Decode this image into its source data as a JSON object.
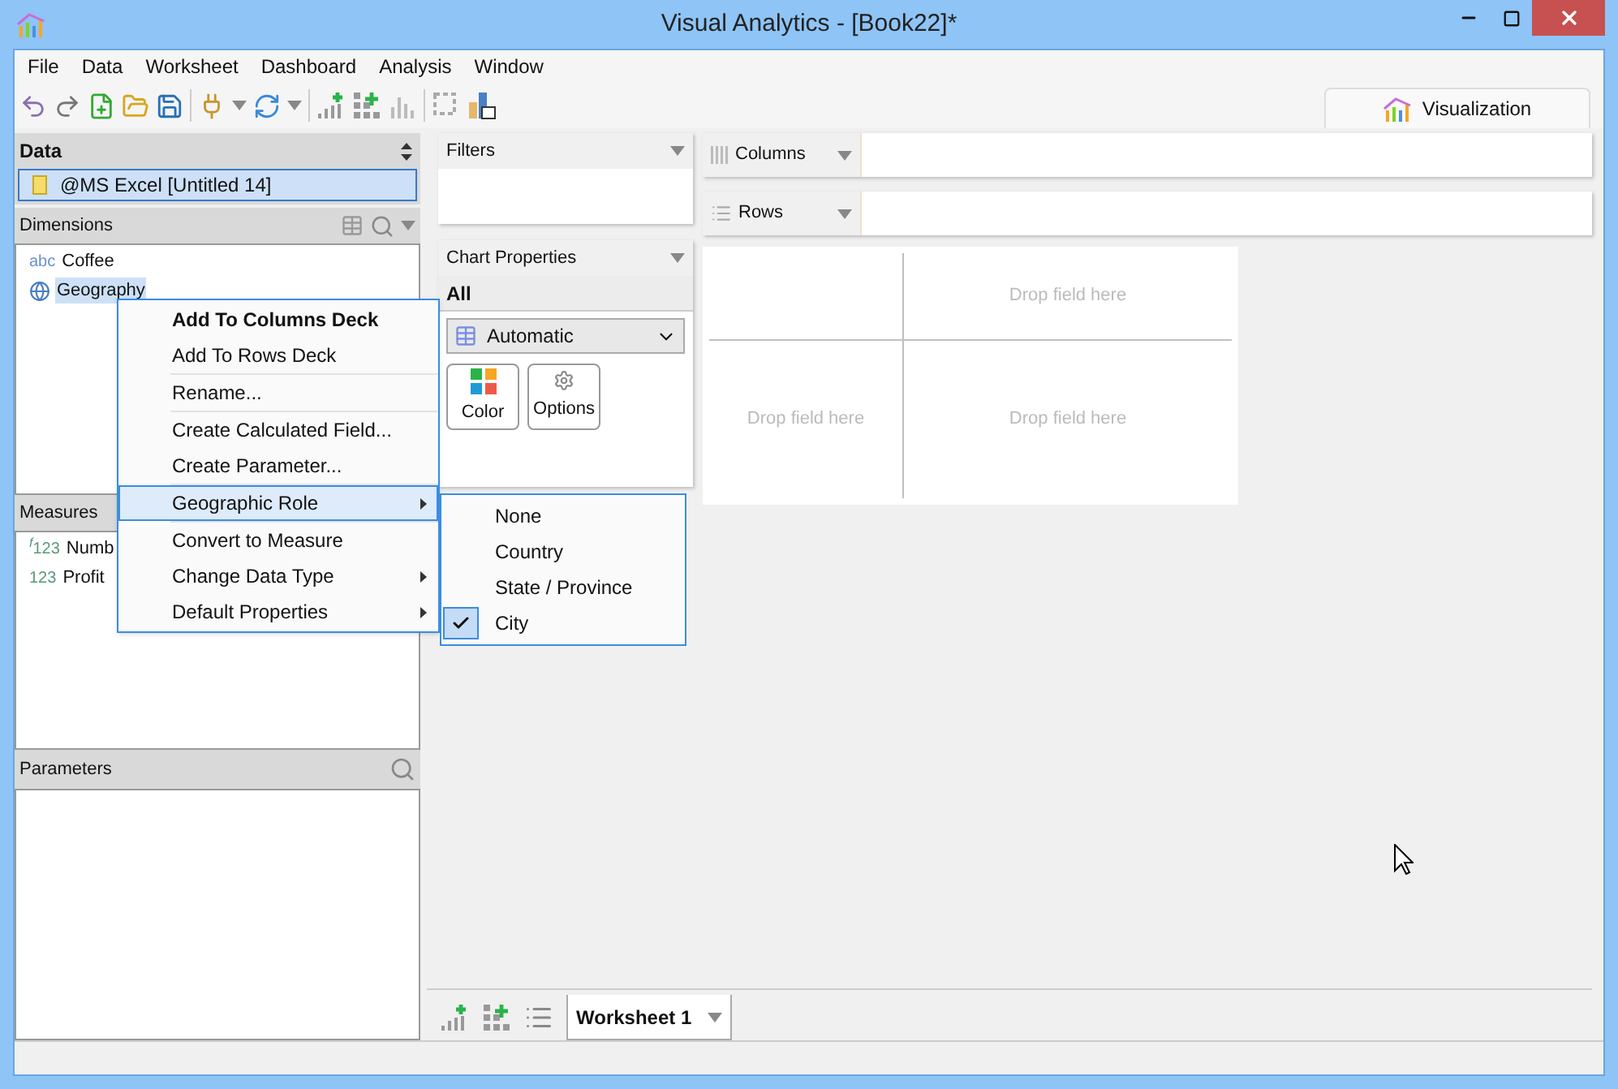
{
  "window": {
    "title": "Visual Analytics - [Book22]*"
  },
  "menu": [
    "File",
    "Data",
    "Worksheet",
    "Dashboard",
    "Analysis",
    "Window"
  ],
  "ribbon_tabs": [
    {
      "label": "Visualization",
      "selected": true
    }
  ],
  "data_panel": {
    "title": "Data",
    "source": {
      "label": "@MS Excel [Untitled 14]",
      "selected": true
    },
    "dimensions": {
      "title": "Dimensions",
      "items": [
        {
          "kind": "badge",
          "badge": "abc",
          "label": "Coffee",
          "selected": false
        },
        {
          "kind": "globe",
          "label": "Geography",
          "selected": true
        }
      ]
    },
    "measures": {
      "title": "Measures",
      "items": [
        {
          "kind": "calc",
          "mark": "f",
          "badge": "123",
          "label": "Numb"
        },
        {
          "kind": "badge",
          "badge": "123",
          "label": "Profit"
        }
      ]
    },
    "parameters": {
      "title": "Parameters"
    }
  },
  "filters": {
    "title": "Filters"
  },
  "chart_properties": {
    "title": "Chart Properties",
    "section": "All",
    "chart_type": "Automatic",
    "buttons": [
      {
        "kind": "color",
        "label": "Color"
      },
      {
        "kind": "options",
        "label": "Options"
      }
    ]
  },
  "shelves": [
    {
      "kind": "columns",
      "label": "Columns"
    },
    {
      "kind": "rows",
      "label": "Rows"
    }
  ],
  "canvas": {
    "drop_zones": [
      "Drop field here",
      "Drop field here",
      "Drop field here"
    ]
  },
  "sheet_tabs": [
    {
      "label": "Worksheet 1",
      "selected": true
    }
  ],
  "context_menu": {
    "groups": [
      [
        {
          "label": "Add To Columns Deck",
          "bold": true,
          "selected": false,
          "has_submenu": false
        },
        {
          "label": "Add To Rows Deck",
          "bold": false,
          "selected": false,
          "has_submenu": false
        }
      ],
      [
        {
          "label": "Rename...",
          "bold": false,
          "selected": false,
          "has_submenu": false
        }
      ],
      [
        {
          "label": "Create Calculated Field...",
          "bold": false,
          "selected": false,
          "has_submenu": false
        },
        {
          "label": "Create Parameter...",
          "bold": false,
          "selected": false,
          "has_submenu": false
        }
      ],
      [
        {
          "label": "Geographic Role",
          "bold": false,
          "selected": true,
          "has_submenu": true
        }
      ],
      [
        {
          "label": "Convert to Measure",
          "bold": false,
          "selected": false,
          "has_submenu": false
        },
        {
          "label": "Change Data Type",
          "bold": false,
          "selected": false,
          "has_submenu": true
        },
        {
          "label": "Default Properties",
          "bold": false,
          "selected": false,
          "has_submenu": true
        }
      ]
    ],
    "submenu": [
      {
        "label": "None",
        "checked": false
      },
      {
        "label": "Country",
        "checked": false
      },
      {
        "label": "State / Province",
        "checked": false
      },
      {
        "label": "City",
        "checked": true
      }
    ]
  }
}
